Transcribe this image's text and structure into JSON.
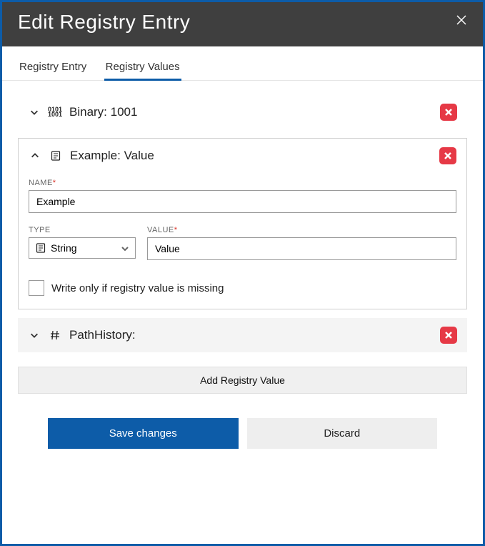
{
  "dialog": {
    "title": "Edit Registry Entry"
  },
  "tabs": {
    "entry": "Registry Entry",
    "values": "Registry Values"
  },
  "items": [
    {
      "label": "Binary: 1001"
    },
    {
      "label": "Example: Value"
    },
    {
      "label": "PathHistory:"
    }
  ],
  "form": {
    "name_label": "NAME",
    "name_value": "Example",
    "type_label": "TYPE",
    "type_value": "String",
    "value_label": "VALUE",
    "value_value": "Value",
    "checkbox_label": "Write only if registry value is missing"
  },
  "buttons": {
    "add": "Add Registry Value",
    "save": "Save changes",
    "discard": "Discard"
  }
}
